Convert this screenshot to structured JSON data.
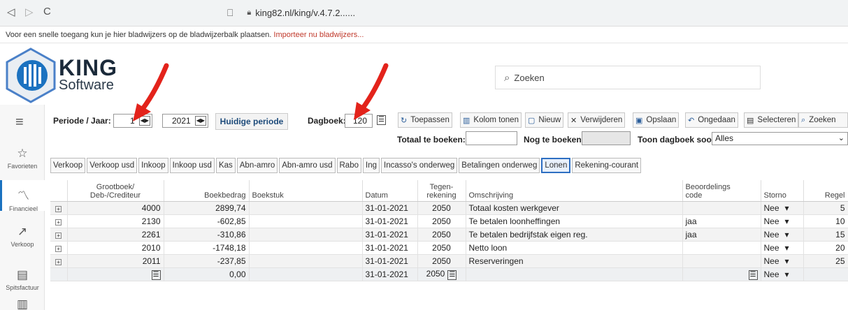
{
  "browser": {
    "back": "◁",
    "forward": "▷",
    "reload": "C",
    "bookmark_icon": "🔖",
    "url": "king82.nl/king/v.4.7.2......",
    "bookmark_hint": "Voor een snelle toegang kun je hier bladwijzers op de bladwijzerbalk plaatsen.",
    "bookmark_link": "Importeer nu bladwijzers..."
  },
  "app": {
    "logo_title": "KING",
    "logo_subtitle": "Software",
    "search_placeholder": "Zoeken",
    "brand_color": "#1b72c0"
  },
  "sidebar": {
    "items": [
      {
        "label": "Favorieten",
        "icon": "☆"
      },
      {
        "label": "Financieel",
        "icon": "〽"
      },
      {
        "label": "Verkoop",
        "icon": "↗"
      },
      {
        "label": "Spitsfactuur",
        "icon": "▤"
      }
    ]
  },
  "toolbar": {
    "periode_label": "Periode / Jaar:",
    "periode_value": "1",
    "jaar_value": "2021",
    "huidige_periode": "Huidige periode",
    "dagboek_label": "Dagboek:",
    "dagboek_value": "120",
    "buttons": [
      {
        "label": "Toepassen",
        "icon": "↻"
      },
      {
        "label": "Kolom tonen",
        "icon": "▥"
      },
      {
        "label": "Nieuw",
        "icon": "▢"
      },
      {
        "label": "Verwijderen",
        "icon": "✕"
      },
      {
        "label": "Opslaan",
        "icon": "▣"
      },
      {
        "label": "Ongedaan",
        "icon": "↶"
      },
      {
        "label": "Selecteren",
        "icon": "▤"
      },
      {
        "label": "Zoeken",
        "icon": "⌕"
      }
    ],
    "totaal_label": "Totaal te boeken:",
    "nog_label": "Nog te boeken:",
    "toon_label": "Toon dagboek soort:",
    "toon_value": "Alles"
  },
  "tabs": [
    "Verkoop",
    "Verkoop usd",
    "Inkoop",
    "Inkoop usd",
    "Kas",
    "Abn-amro",
    "Abn-amro usd",
    "Rabo",
    "Ing",
    "Incasso's onderweg",
    "Betalingen onderweg",
    "Lonen",
    "Rekening-courant"
  ],
  "active_tab": "Lonen",
  "table": {
    "headers": {
      "grootboek": "Grootboek/\nDeb-/Crediteur",
      "boekbedrag": "Boekbedrag",
      "boekstuk": "Boekstuk",
      "datum": "Datum",
      "tegen": "Tegen-\nrekening",
      "omschrijving": "Omschrijving",
      "beoordeling": "Beoordelings\ncode",
      "storno": "Storno",
      "regel": "Regel"
    },
    "rows": [
      {
        "grootboek": "4000",
        "boekbedrag": "2899,74",
        "boekstuk": "",
        "datum": "31-01-2021",
        "tegen": "2050",
        "omschrijving": "Totaal kosten werkgever",
        "beoordeling": "",
        "storno": "Nee",
        "regel": "5"
      },
      {
        "grootboek": "2130",
        "boekbedrag": "-602,85",
        "boekstuk": "",
        "datum": "31-01-2021",
        "tegen": "2050",
        "omschrijving": "Te betalen loonheffingen",
        "beoordeling": "jaa",
        "storno": "Nee",
        "regel": "10"
      },
      {
        "grootboek": "2261",
        "boekbedrag": "-310,86",
        "boekstuk": "",
        "datum": "31-01-2021",
        "tegen": "2050",
        "omschrijving": "Te betalen bedrijfstak eigen reg.",
        "beoordeling": "jaa",
        "storno": "Nee",
        "regel": "15"
      },
      {
        "grootboek": "2010",
        "boekbedrag": "-1748,18",
        "boekstuk": "",
        "datum": "31-01-2021",
        "tegen": "2050",
        "omschrijving": "Netto loon",
        "beoordeling": "",
        "storno": "Nee",
        "regel": "20"
      },
      {
        "grootboek": "2011",
        "boekbedrag": "-237,85",
        "boekstuk": "",
        "datum": "31-01-2021",
        "tegen": "2050",
        "omschrijving": "Reserveringen",
        "beoordeling": "",
        "storno": "Nee",
        "regel": "25"
      }
    ],
    "new_row": {
      "boekbedrag": "0,00",
      "datum": "31-01-2021",
      "tegen": "2050",
      "storno": "Nee"
    }
  },
  "annotation_color": "#e3231b"
}
